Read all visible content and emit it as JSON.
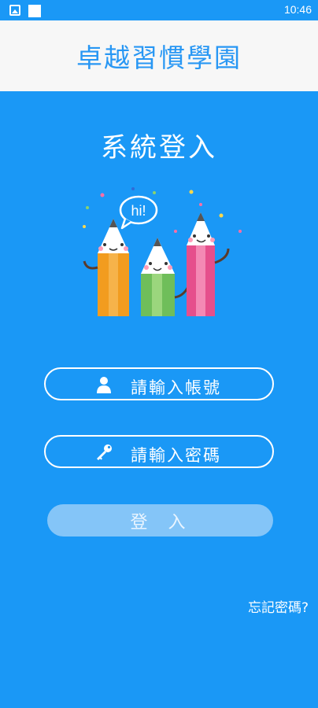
{
  "status_bar": {
    "time": "10:46"
  },
  "header": {
    "title": "卓越習慣學園"
  },
  "login": {
    "title": "系統登入",
    "illustration_text": "hi!",
    "account_placeholder": "請輸入帳號",
    "password_placeholder": "請輸入密碼",
    "submit_label": "登入",
    "forgot_label": "忘記密碼?"
  },
  "icons": {
    "account": "user-icon",
    "password": "key-icon"
  },
  "colors": {
    "background": "#1a98f6",
    "header_bg": "#f7f7f7",
    "title_blue": "#2897f4",
    "button_bg": "#84c5f8"
  }
}
